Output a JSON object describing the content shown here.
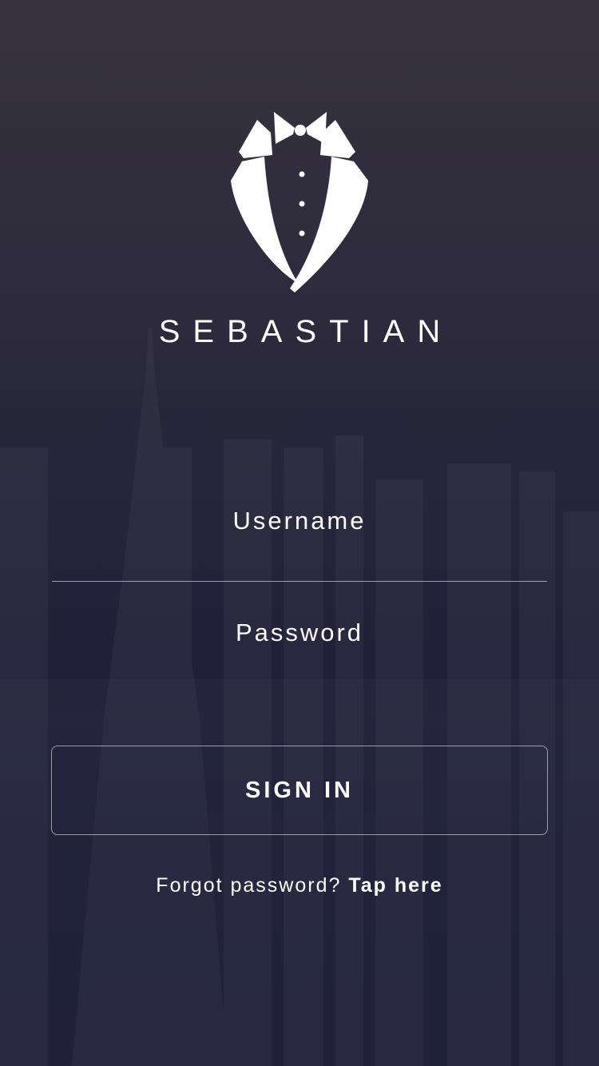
{
  "app": {
    "brand_name": "SEBASTIAN",
    "logo_icon": "tuxedo-icon"
  },
  "login_form": {
    "username_placeholder": "Username",
    "username_value": "",
    "password_placeholder": "Password",
    "password_value": "",
    "signin_label": "SIGN IN",
    "forgot_prompt": "Forgot password?",
    "forgot_link": "Tap here"
  },
  "colors": {
    "background_top": "#37333f",
    "background_bottom": "#1a1c35",
    "text": "#ffffff",
    "border": "#8e8d9c"
  }
}
